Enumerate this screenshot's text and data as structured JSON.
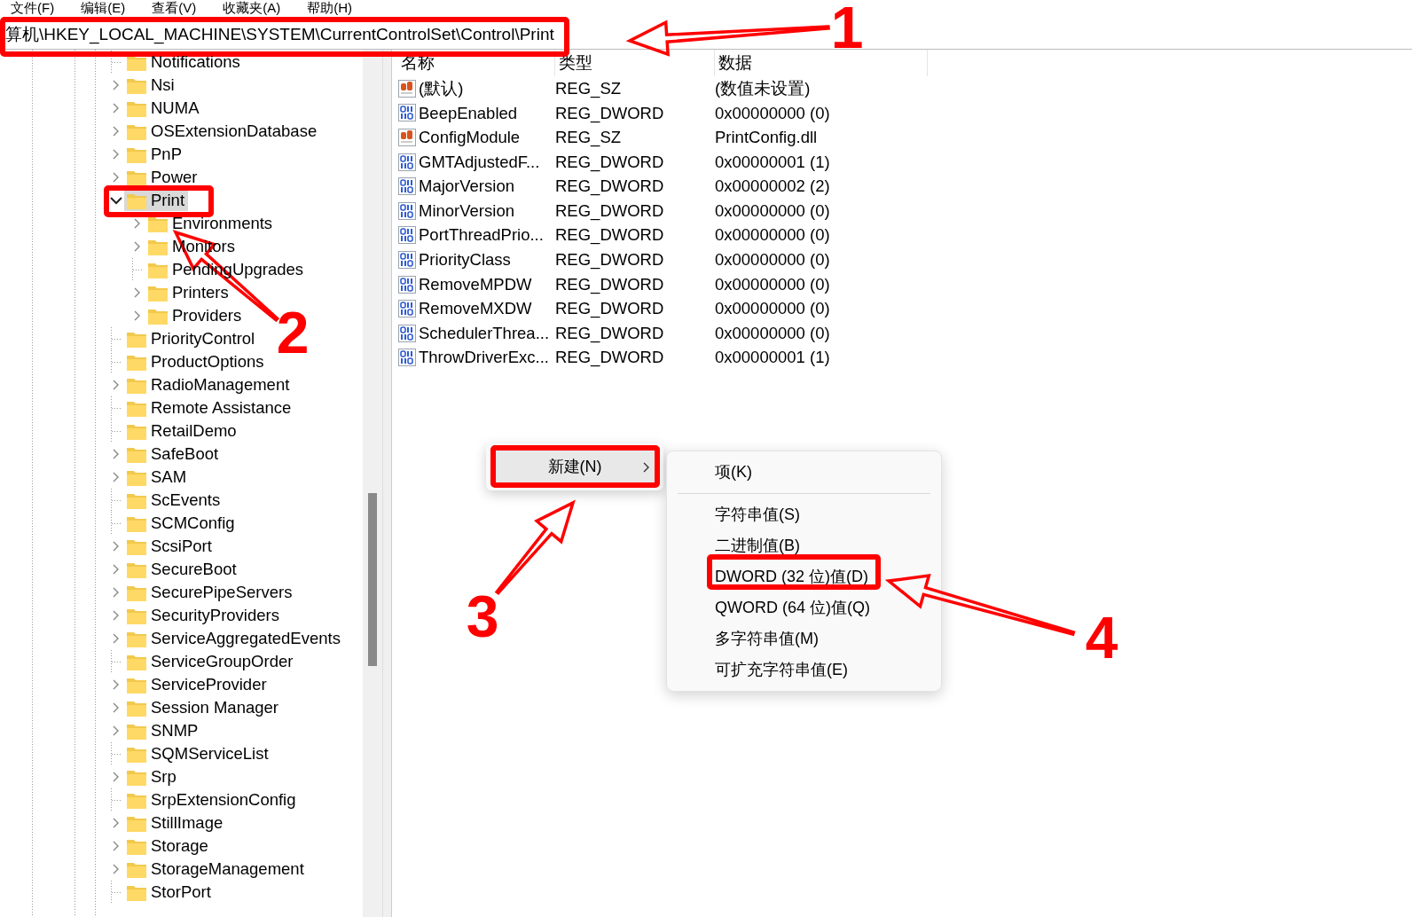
{
  "menu_bar": [
    {
      "label": "文件(F)"
    },
    {
      "label": "编辑(E)"
    },
    {
      "label": "查看(V)"
    },
    {
      "label": "收藏夹(A)"
    },
    {
      "label": "帮助(H)"
    }
  ],
  "address_bar": {
    "path": "算机\\HKEY_LOCAL_MACHINE\\SYSTEM\\CurrentControlSet\\Control\\Print"
  },
  "tree": [
    {
      "label": "Notifications",
      "kind": "leaf",
      "selected": false
    },
    {
      "label": "Nsi",
      "kind": "branch",
      "expanded": false,
      "selected": false
    },
    {
      "label": "NUMA",
      "kind": "branch",
      "expanded": false,
      "selected": false
    },
    {
      "label": "OSExtensionDatabase",
      "kind": "branch",
      "expanded": false,
      "selected": false
    },
    {
      "label": "PnP",
      "kind": "branch",
      "expanded": false,
      "selected": false
    },
    {
      "label": "Power",
      "kind": "branch",
      "expanded": false,
      "selected": false
    },
    {
      "label": "Print",
      "kind": "branch",
      "expanded": true,
      "selected": true,
      "children": [
        {
          "label": "Environments",
          "kind": "branch",
          "expanded": false,
          "selected": false
        },
        {
          "label": "Monitors",
          "kind": "branch",
          "expanded": false,
          "selected": false
        },
        {
          "label": "PendingUpgrades",
          "kind": "leaf",
          "selected": false
        },
        {
          "label": "Printers",
          "kind": "branch",
          "expanded": false,
          "selected": false
        },
        {
          "label": "Providers",
          "kind": "branch",
          "expanded": false,
          "selected": false
        }
      ]
    },
    {
      "label": "PriorityControl",
      "kind": "leaf",
      "selected": false
    },
    {
      "label": "ProductOptions",
      "kind": "leaf",
      "selected": false
    },
    {
      "label": "RadioManagement",
      "kind": "branch",
      "expanded": false,
      "selected": false
    },
    {
      "label": "Remote Assistance",
      "kind": "leaf",
      "selected": false
    },
    {
      "label": "RetailDemo",
      "kind": "leaf",
      "selected": false
    },
    {
      "label": "SafeBoot",
      "kind": "branch",
      "expanded": false,
      "selected": false
    },
    {
      "label": "SAM",
      "kind": "branch",
      "expanded": false,
      "selected": false
    },
    {
      "label": "ScEvents",
      "kind": "leaf",
      "selected": false
    },
    {
      "label": "SCMConfig",
      "kind": "leaf",
      "selected": false
    },
    {
      "label": "ScsiPort",
      "kind": "branch",
      "expanded": false,
      "selected": false
    },
    {
      "label": "SecureBoot",
      "kind": "branch",
      "expanded": false,
      "selected": false
    },
    {
      "label": "SecurePipeServers",
      "kind": "branch",
      "expanded": false,
      "selected": false
    },
    {
      "label": "SecurityProviders",
      "kind": "branch",
      "expanded": false,
      "selected": false
    },
    {
      "label": "ServiceAggregatedEvents",
      "kind": "branch",
      "expanded": false,
      "selected": false
    },
    {
      "label": "ServiceGroupOrder",
      "kind": "leaf",
      "selected": false
    },
    {
      "label": "ServiceProvider",
      "kind": "branch",
      "expanded": false,
      "selected": false
    },
    {
      "label": "Session Manager",
      "kind": "branch",
      "expanded": false,
      "selected": false
    },
    {
      "label": "SNMP",
      "kind": "branch",
      "expanded": false,
      "selected": false
    },
    {
      "label": "SQMServiceList",
      "kind": "leaf",
      "selected": false
    },
    {
      "label": "Srp",
      "kind": "branch",
      "expanded": false,
      "selected": false
    },
    {
      "label": "SrpExtensionConfig",
      "kind": "leaf",
      "selected": false
    },
    {
      "label": "StillImage",
      "kind": "branch",
      "expanded": false,
      "selected": false
    },
    {
      "label": "Storage",
      "kind": "branch",
      "expanded": false,
      "selected": false
    },
    {
      "label": "StorageManagement",
      "kind": "branch",
      "expanded": false,
      "selected": false
    },
    {
      "label": "StorPort",
      "kind": "leaf",
      "selected": false
    }
  ],
  "values_table": {
    "columns": [
      "名称",
      "类型",
      "数据"
    ],
    "rows": [
      {
        "kind": "string",
        "name": "(默认)",
        "type": "REG_SZ",
        "data": "(数值未设置)"
      },
      {
        "kind": "binary",
        "name": "BeepEnabled",
        "type": "REG_DWORD",
        "data": "0x00000000 (0)"
      },
      {
        "kind": "string",
        "name": "ConfigModule",
        "type": "REG_SZ",
        "data": "PrintConfig.dll"
      },
      {
        "kind": "binary",
        "name": "GMTAdjustedF...",
        "type": "REG_DWORD",
        "data": "0x00000001 (1)"
      },
      {
        "kind": "binary",
        "name": "MajorVersion",
        "type": "REG_DWORD",
        "data": "0x00000002 (2)"
      },
      {
        "kind": "binary",
        "name": "MinorVersion",
        "type": "REG_DWORD",
        "data": "0x00000000 (0)"
      },
      {
        "kind": "binary",
        "name": "PortThreadPrio...",
        "type": "REG_DWORD",
        "data": "0x00000000 (0)"
      },
      {
        "kind": "binary",
        "name": "PriorityClass",
        "type": "REG_DWORD",
        "data": "0x00000000 (0)"
      },
      {
        "kind": "binary",
        "name": "RemoveMPDW",
        "type": "REG_DWORD",
        "data": "0x00000000 (0)"
      },
      {
        "kind": "binary",
        "name": "RemoveMXDW",
        "type": "REG_DWORD",
        "data": "0x00000000 (0)"
      },
      {
        "kind": "binary",
        "name": "SchedulerThrea...",
        "type": "REG_DWORD",
        "data": "0x00000000 (0)"
      },
      {
        "kind": "binary",
        "name": "ThrowDriverExc...",
        "type": "REG_DWORD",
        "data": "0x00000001 (1)"
      }
    ]
  },
  "context_menu": {
    "items": [
      {
        "label": "新建(N)",
        "selected": true
      }
    ]
  },
  "submenu": {
    "items": [
      {
        "kind": "item",
        "label": "项(K)"
      },
      {
        "kind": "separator"
      },
      {
        "kind": "item",
        "label": "字符串值(S)"
      },
      {
        "kind": "item",
        "label": "二进制值(B)"
      },
      {
        "kind": "item",
        "label": "DWORD (32 位)值(D)"
      },
      {
        "kind": "item",
        "label": "QWORD (64 位)值(Q)"
      },
      {
        "kind": "item",
        "label": "多字符串值(M)"
      },
      {
        "kind": "item",
        "label": "可扩充字符串值(E)"
      }
    ]
  },
  "annotations": [
    {
      "number": "1"
    },
    {
      "number": "2"
    },
    {
      "number": "3"
    },
    {
      "number": "4"
    }
  ]
}
